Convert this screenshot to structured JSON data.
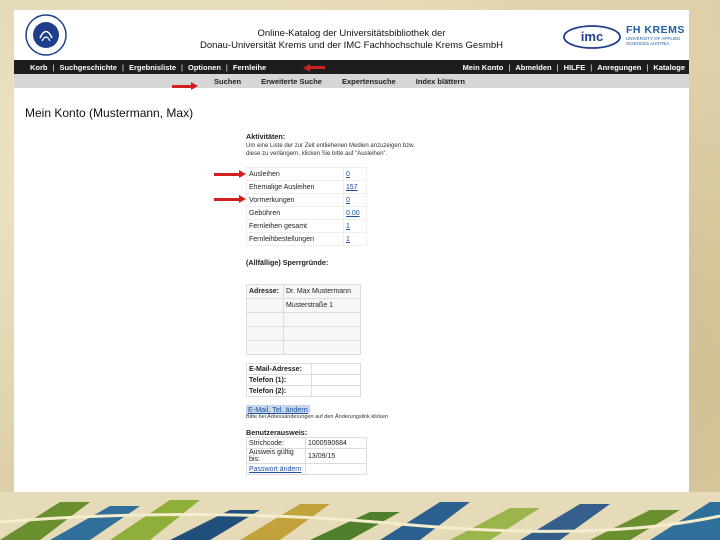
{
  "header": {
    "title_line1": "Online-Katalog der Universitätsbibliothek der",
    "title_line2": "Donau-Universität Krems und der IMC Fachhochschule Krems GesmbH",
    "logo_left_text": "DONAU UNIVERSITÄT KREMS",
    "imc_logo": "imc",
    "fh_title": "FH KREMS",
    "fh_sub1": "UNIVERSITY OF APPLIED",
    "fh_sub2": "SCIENCES AUSTRIA"
  },
  "nav1": {
    "left": [
      "Korb",
      "Suchgeschichte",
      "Ergebnisliste",
      "Optionen",
      "Fernleihe"
    ],
    "right": [
      "Mein Konto",
      "Abmelden",
      "HILFE",
      "Anregungen",
      "Kataloge"
    ]
  },
  "nav2": [
    "Suchen",
    "Erweiterte Suche",
    "Expertensuche",
    "Index blättern"
  ],
  "page_title": "Mein Konto (Mustermann, Max)",
  "activities": {
    "title": "Aktivitäten:",
    "desc": "Um eine Liste der zur Zeit entliehenen Medien anzuzeigen bzw. diese zu verlängern, klicken Sie bitte auf \"Ausleihen\".",
    "rows": [
      {
        "label": "Ausleihen",
        "value": "0"
      },
      {
        "label": "Ehemalige Ausleihen",
        "value": "157"
      },
      {
        "label": "Vormerkungen",
        "value": "0"
      },
      {
        "label": "Gebühren",
        "value": "0.00"
      },
      {
        "label": "Fernleihen gesamt",
        "value": "1"
      },
      {
        "label": "Fernleihbestellungen",
        "value": "1"
      }
    ]
  },
  "blocks_title": "(Allfällige) Sperrgründe:",
  "address": {
    "label": "Adresse:",
    "line1": "Dr. Max Mustermann",
    "line2": "Musterstraße 1"
  },
  "contact": {
    "email_label": "E-Mail-Adresse:",
    "phone1_label": "Telefon (1):",
    "phone2_label": "Telefon (2):"
  },
  "email_change_link": "E-Mail, Tel. ändern",
  "email_change_note": "Bitte bei Adressänderungen auf den Änderungslink klicken",
  "card": {
    "title": "Benutzerausweis:",
    "barcode_label": "Strichcode:",
    "barcode_value": "1000590684",
    "valid_label": "Ausweis gültig bis:",
    "valid_value": "13/09/15",
    "password_link": "Passwort ändern"
  },
  "colors": {
    "nav_bg": "#1d1d1d",
    "arrow": "#d21f1f",
    "link": "#1f4fa0"
  }
}
